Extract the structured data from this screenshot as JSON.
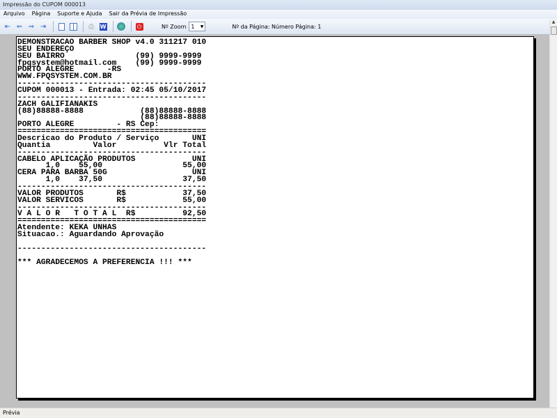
{
  "window": {
    "title": "Impressão do CUPOM 000013"
  },
  "menu": [
    "Arquivo",
    "Página",
    "Suporte e Ajuda",
    "Sair da Prévia de Impressão"
  ],
  "toolbar": {
    "zoom_label": "Nº Zoom",
    "zoom_value": "1",
    "page_label": "Nº da Página: Número Página: 1"
  },
  "receipt": [
    "DEMONSTRACAO BARBER SHOP v4.0 311217 010",
    "SEU ENDEREÇO",
    "SEU BAIRRO               (99) 9999-9999",
    "fpqsystem@hotmail.com    (99) 9999-9999",
    "PORTO ALEGRE       -RS",
    "WWW.FPQSYSTEM.COM.BR",
    "----------------------------------------",
    "CUPOM 000013 - Entrada: 02:45 05/10/2017",
    "----------------------------------------",
    "ZACH GALIFIANAKIS",
    "(88)88888-8888            (88)88888-8888",
    "                          (88)88888-8888",
    "PORTO ALEGRE         - RS Cep:",
    "========================================",
    "Descricao do Produto / Serviço       UNI",
    "Quantia         Valor          Vlr Total",
    "----------------------------------------",
    "CABELO APLICAÇÃO PRODUTOS            UNI",
    "      1,0    55,00                 55,00",
    "CERA PARA BARBA 50G                  UNI",
    "      1,0    37,50                 37,50",
    "----------------------------------------",
    "VALOR PRODUTOS       R$            37,50",
    "VALOR SERVICOS       R$            55,00",
    "----------------------------------------",
    "V A L O R   T O T A L  R$          92,50",
    "========================================",
    "Atendente: KEKA UNHAS",
    "Situacao.: Aguardando Aprovação",
    "",
    "----------------------------------------",
    "",
    "*** AGRADECEMOS A PREFERENCIA !!! ***"
  ],
  "status": {
    "text": "Prévia"
  }
}
